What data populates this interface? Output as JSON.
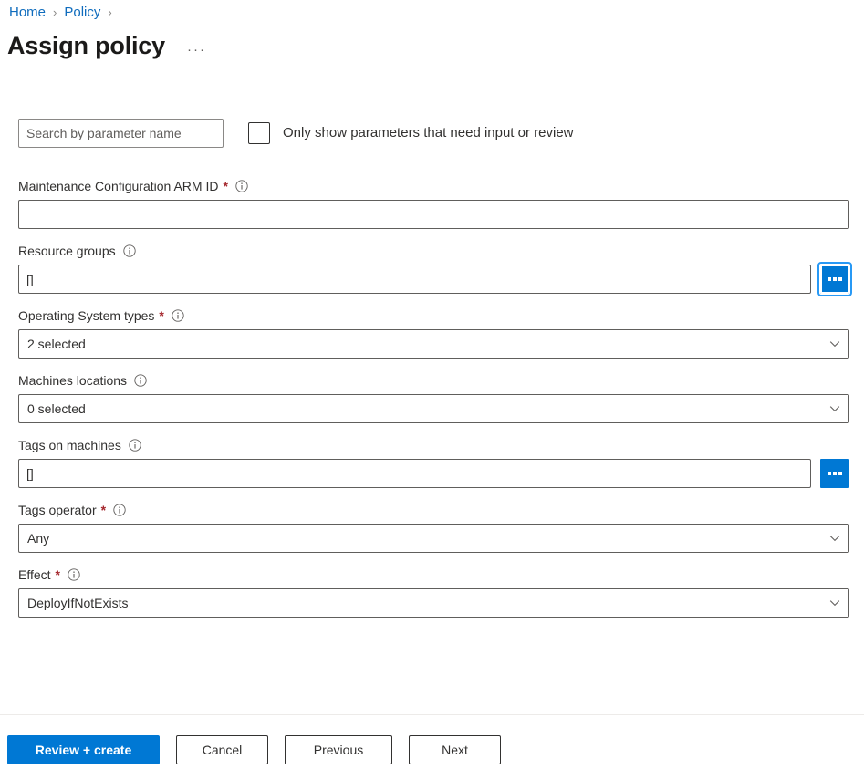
{
  "breadcrumb": {
    "items": [
      {
        "label": "Home",
        "separator": "›"
      },
      {
        "label": "Policy",
        "separator": "›"
      }
    ],
    "home_label": "Home",
    "policy_label": "Policy",
    "sep1": "›",
    "sep2": "›"
  },
  "header": {
    "title": "Assign policy",
    "more_menu": "···"
  },
  "filters": {
    "search_placeholder": "Search by parameter name",
    "search_value": "",
    "only_needed_label": "Only show parameters that need input or review",
    "only_needed_checked": false
  },
  "fields": [
    {
      "label": "Maintenance Configuration ARM ID",
      "required": true,
      "has_info": true,
      "type": "text",
      "value": ""
    },
    {
      "label": "Resource groups",
      "required": false,
      "has_info": true,
      "type": "text-with-picker",
      "value": "[]",
      "picker_label": "..."
    },
    {
      "label": "Operating System types",
      "required": true,
      "has_info": true,
      "type": "dropdown",
      "value": "2 selected"
    },
    {
      "label": "Machines locations",
      "required": false,
      "has_info": true,
      "type": "dropdown",
      "value": "0 selected"
    },
    {
      "label": "Tags on machines",
      "required": false,
      "has_info": true,
      "type": "text-with-picker",
      "value": "[]",
      "picker_label": "..."
    },
    {
      "label": "Tags operator",
      "required": true,
      "has_info": true,
      "type": "dropdown",
      "value": "Any"
    },
    {
      "label": "Effect",
      "required": true,
      "has_info": true,
      "type": "dropdown",
      "value": "DeployIfNotExists"
    }
  ],
  "field_labels": {
    "arm_id": "Maintenance Configuration ARM ID",
    "resource_groups": "Resource groups",
    "os_types": "Operating System types",
    "machines_locations": "Machines locations",
    "tags_on_machines": "Tags on machines",
    "tags_operator": "Tags operator",
    "effect": "Effect"
  },
  "field_values": {
    "arm_id": "",
    "resource_groups": "[]",
    "os_types": "2 selected",
    "machines_locations": "0 selected",
    "tags_on_machines": "[]",
    "tags_operator": "Any",
    "effect": "DeployIfNotExists"
  },
  "required_marker": "*",
  "footer": {
    "review_create": "Review + create",
    "cancel": "Cancel",
    "previous": "Previous",
    "next": "Next"
  },
  "colors": {
    "accent": "#0078d4",
    "link": "#0f6cbd",
    "required": "#a4262c",
    "text": "#323130",
    "border": "#605e5c",
    "divider": "#edebe9"
  }
}
